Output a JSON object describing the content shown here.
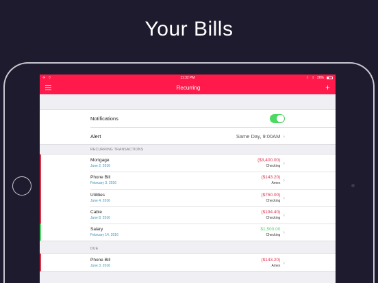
{
  "headline": "Your Bills",
  "colors": {
    "accent": "#ff1a4b",
    "expense": "#e0314b",
    "income": "#4cd964",
    "date": "#3a92b5"
  },
  "status_bar": {
    "time": "11:32 PM",
    "battery": "26%"
  },
  "navbar": {
    "title": "Recurring",
    "menu_icon": "hamburger-icon",
    "add_icon": "plus-icon"
  },
  "settings": {
    "notifications_label": "Notifications",
    "notifications_on": true,
    "alert_label": "Alert",
    "alert_value": "Same Day, 9:00AM"
  },
  "recurring": {
    "header": "RECURRING TRANSACTIONS",
    "items": [
      {
        "name": "Mortgage",
        "date": "June 2, 2016",
        "amount": "($3,400.00)",
        "account": "Checking",
        "kind": "expense"
      },
      {
        "name": "Phone Bill",
        "date": "February 3, 2016",
        "amount": "($143.20)",
        "account": "Amex",
        "kind": "expense"
      },
      {
        "name": "Utilities",
        "date": "June 4, 2016",
        "amount": "($750.00)",
        "account": "Checking",
        "kind": "expense"
      },
      {
        "name": "Cable",
        "date": "June 8, 2016",
        "amount": "($194.40)",
        "account": "Checking",
        "kind": "expense"
      },
      {
        "name": "Salary",
        "date": "February 14, 2016",
        "amount": "$1,500.00",
        "account": "Checking",
        "kind": "income"
      }
    ]
  },
  "due": {
    "header": "DUE",
    "items": [
      {
        "name": "Phone Bill",
        "date": "June 3, 2016",
        "amount": "($143.20)",
        "account": "Amex",
        "kind": "expense"
      }
    ]
  }
}
